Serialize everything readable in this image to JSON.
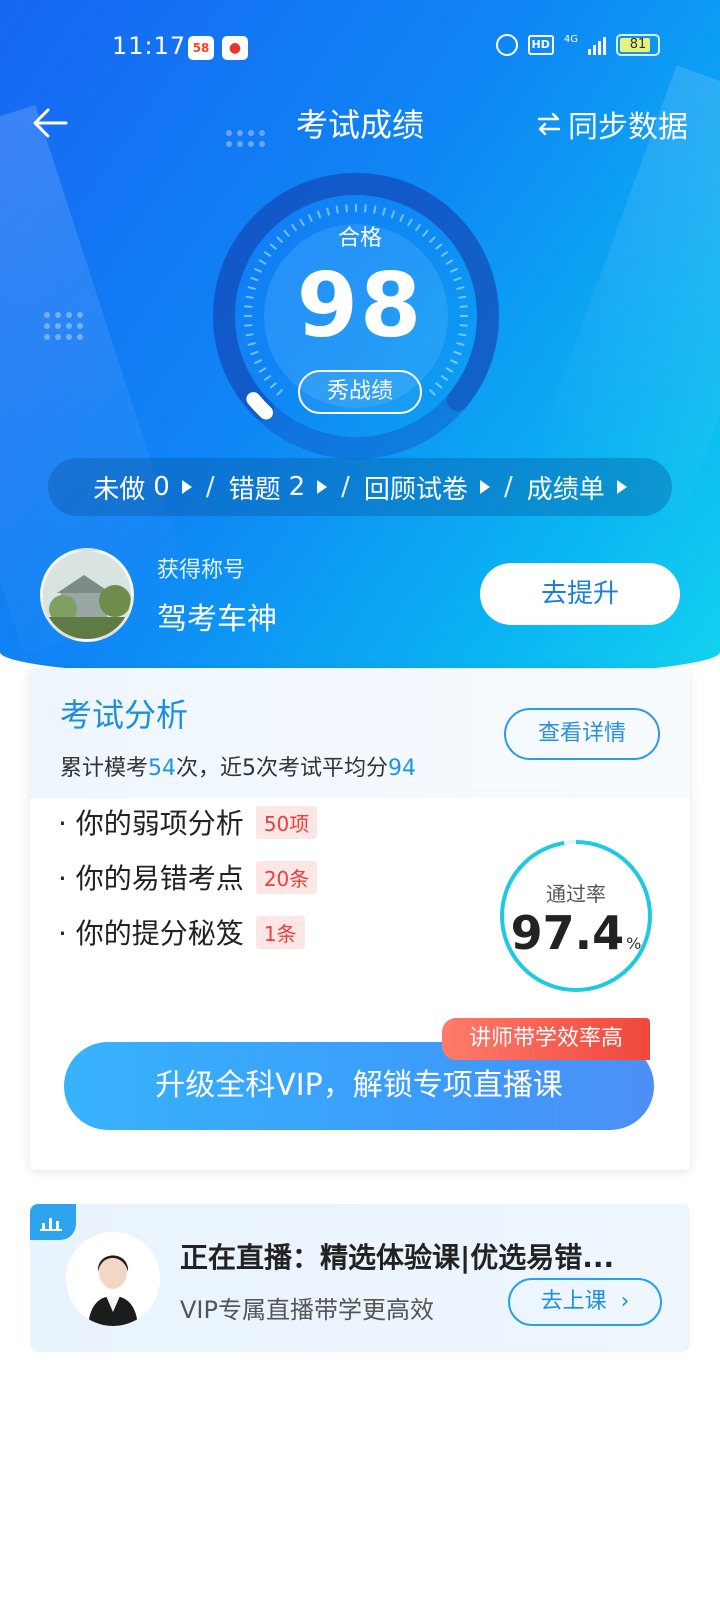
{
  "status_bar": {
    "time": "11:17",
    "app_icon_1": "58",
    "app_icon_2": "map-pin-app-icon",
    "network": "4G",
    "hd": "HD",
    "battery": "81"
  },
  "header": {
    "title": "考试成绩",
    "sync_label": "同步数据"
  },
  "score_panel": {
    "grade": "合格",
    "score": "98",
    "score_value": 98,
    "score_max": 100,
    "show_button": "秀战绩"
  },
  "quick_bar": {
    "items": [
      {
        "label": "未做",
        "count": "0"
      },
      {
        "label": "错题",
        "count": "2"
      },
      {
        "label": "回顾试卷",
        "count": ""
      },
      {
        "label": "成绩单",
        "count": ""
      }
    ],
    "separator": "/"
  },
  "title_row": {
    "caption": "获得称号",
    "value": "驾考车神",
    "button": "去提升"
  },
  "analysis": {
    "title": "考试分析",
    "sub_prefix": "累计模考",
    "sub_count": "54",
    "sub_middle": "次，近5次考试平均分",
    "sub_avg": "94",
    "detail_button": "查看详情",
    "items": [
      {
        "label": "· 你的弱项分析",
        "badge": "50项"
      },
      {
        "label": "· 你的易错考点",
        "badge": "20条"
      },
      {
        "label": "· 你的提分秘笈",
        "badge": "1条"
      }
    ],
    "pass_rate_label": "通过率",
    "pass_rate": "97.4",
    "pass_rate_unit": "%",
    "vip_button": "升级全科VIP，解锁专项直播课",
    "vip_tag": "讲师带学效率高"
  },
  "live": {
    "title": "正在直播：精选体验课|优选易错...",
    "subtitle": "VIP专属直播带学更高效",
    "button": "去上课"
  },
  "colors": {
    "hero_start": "#1766f2",
    "hero_end": "#13d3f0",
    "accent": "#1e8fe0",
    "badge_red": "#e8403a",
    "ring": "#1fc9e0"
  }
}
